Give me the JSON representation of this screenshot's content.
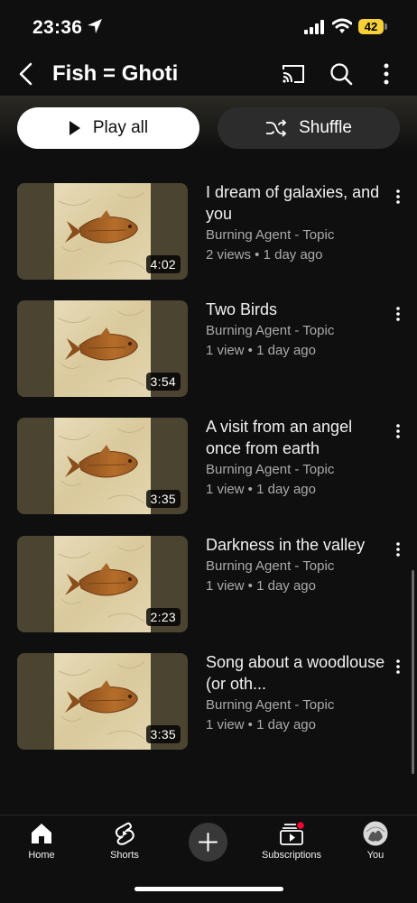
{
  "status": {
    "time": "23:36",
    "battery": "42"
  },
  "header": {
    "title": "Fish = Ghoti"
  },
  "actions": {
    "play_all": "Play all",
    "shuffle": "Shuffle"
  },
  "videos": [
    {
      "title": "I dream of galaxies, and you",
      "channel": "Burning Agent - Topic",
      "meta": "2 views • 1 day ago",
      "duration": "4:02"
    },
    {
      "title": "Two Birds",
      "channel": "Burning Agent - Topic",
      "meta": "1 view • 1 day ago",
      "duration": "3:54"
    },
    {
      "title": "A visit from an angel once from earth",
      "channel": "Burning Agent - Topic",
      "meta": "1 view • 1 day ago",
      "duration": "3:35"
    },
    {
      "title": "Darkness in the valley",
      "channel": "Burning Agent - Topic",
      "meta": "1 view • 1 day ago",
      "duration": "2:23"
    },
    {
      "title": "Song about a woodlouse (or oth...",
      "channel": "Burning Agent - Topic",
      "meta": "1 view • 1 day ago",
      "duration": "3:35"
    }
  ],
  "nav": {
    "home": "Home",
    "shorts": "Shorts",
    "subscriptions": "Subscriptions",
    "you": "You"
  },
  "colors": {
    "background": "#0f0f0f",
    "battery": "#f5d038",
    "notification_dot": "#ff0033"
  }
}
